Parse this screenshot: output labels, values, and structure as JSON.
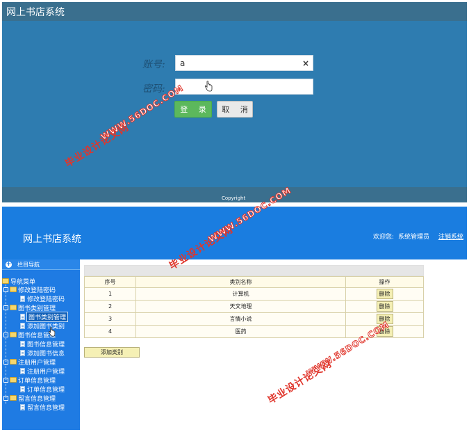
{
  "login": {
    "title": "网上书店系统",
    "account_label": "账号:",
    "password_label": "密码:",
    "account_value": "a",
    "clear_icon": "×",
    "login_button": "登 录",
    "cancel_button": "取 消",
    "footer": "Copyright"
  },
  "admin": {
    "title": "网上书店系统",
    "welcome": "欢迎您:",
    "user": "系统管理员",
    "logout": "注销系统",
    "sidebar": {
      "head": "栏目导航",
      "root": "导航菜单",
      "groups": [
        {
          "label": "修改登陆密码",
          "children": [
            "修改登陆密码"
          ]
        },
        {
          "label": "图书类别管理",
          "children": [
            "图书类别管理",
            "添加图书类别"
          ]
        },
        {
          "label": "图书信息管理",
          "children": [
            "图书信息管理",
            "添加图书信息"
          ]
        },
        {
          "label": "注册用户管理",
          "children": [
            "注册用户管理"
          ]
        },
        {
          "label": "订单信息管理",
          "children": [
            "订单信息管理"
          ]
        },
        {
          "label": "留言信息管理",
          "children": [
            "留言信息管理"
          ]
        }
      ]
    },
    "table": {
      "headers": [
        "序号",
        "类别名称",
        "操作"
      ],
      "rows": [
        {
          "no": "1",
          "name": "计算机",
          "action": "删除"
        },
        {
          "no": "2",
          "name": "天文地理",
          "action": "删除"
        },
        {
          "no": "3",
          "name": "言情小说",
          "action": "删除"
        },
        {
          "no": "4",
          "name": "医药",
          "action": "删除"
        }
      ]
    },
    "add_button": "添加类别"
  },
  "watermark": {
    "cn": "毕业设计论文网",
    "url": "WWW.56DOC.COM",
    "color": "#e0352b"
  }
}
